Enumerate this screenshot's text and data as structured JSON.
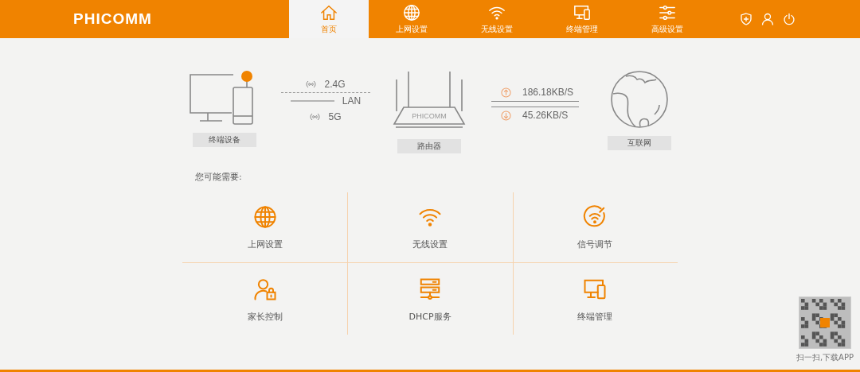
{
  "header": {
    "logo": "PHICOMM",
    "nav": [
      {
        "label": "首页",
        "kind": "home",
        "selected": true
      },
      {
        "label": "上网设置",
        "kind": "globe",
        "selected": false
      },
      {
        "label": "无线设置",
        "kind": "wifi",
        "selected": false
      },
      {
        "label": "终端管理",
        "kind": "devices",
        "selected": false
      },
      {
        "label": "高级设置",
        "kind": "sliders",
        "selected": false
      }
    ]
  },
  "topology": {
    "devices_label": "终端设备",
    "links": [
      {
        "kind": "wifi",
        "label": "2.4G"
      },
      {
        "kind": "wired",
        "label": "LAN"
      },
      {
        "kind": "wifi",
        "label": "5G"
      }
    ],
    "router_label": "路由器",
    "router_brand": "PHICOMM",
    "speeds": [
      {
        "kind": "up",
        "value": "186.18KB/S"
      },
      {
        "kind": "down",
        "value": "45.26KB/S"
      }
    ],
    "internet_label": "互联网"
  },
  "quick": {
    "title": "您可能需要:",
    "items": [
      {
        "kind": "globe",
        "label": "上网设置"
      },
      {
        "kind": "wifi",
        "label": "无线设置"
      },
      {
        "kind": "signal",
        "label": "信号调节"
      },
      {
        "kind": "parental",
        "label": "家长控制"
      },
      {
        "kind": "server",
        "label": "DHCP服务"
      },
      {
        "kind": "devices",
        "label": "终端管理"
      }
    ]
  },
  "qr": {
    "caption": "扫一扫,下载APP"
  }
}
